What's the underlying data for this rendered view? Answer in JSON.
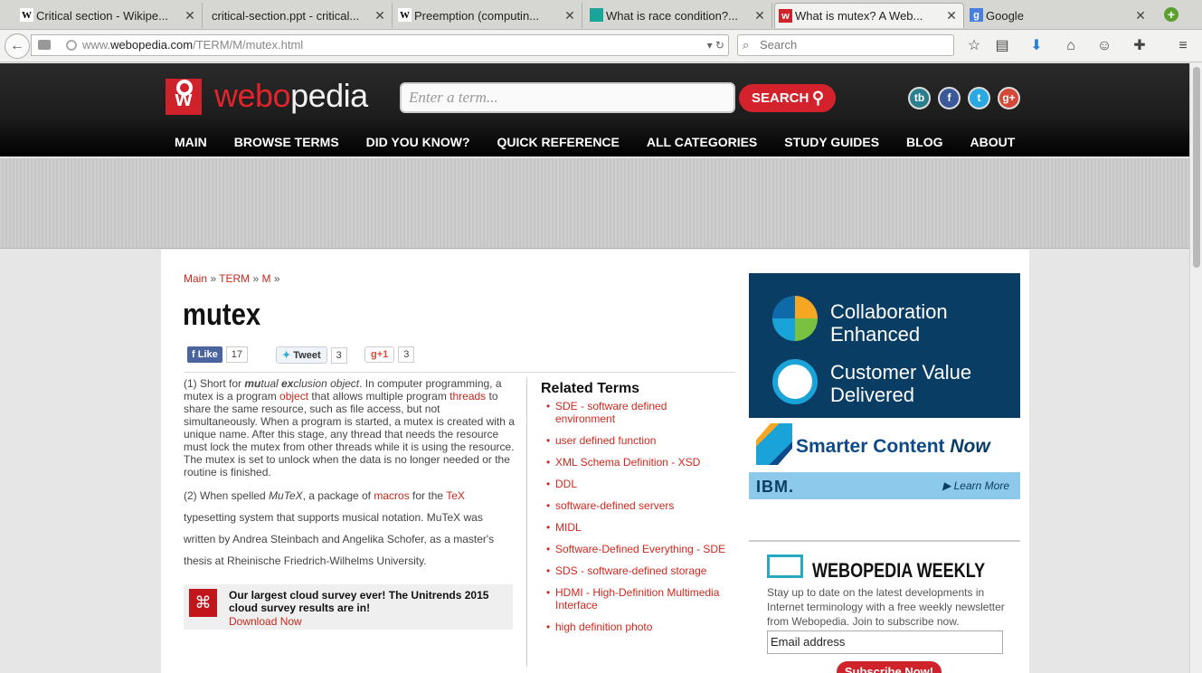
{
  "browser": {
    "tabs": [
      {
        "title": "Critical section - Wikipe...",
        "favicon": "W",
        "active": false
      },
      {
        "title": "critical-section.ppt - critical...",
        "favicon": "",
        "active": false
      },
      {
        "title": "Preemption (computin...",
        "favicon": "W",
        "active": false
      },
      {
        "title": "What is race condition?...",
        "favicon": "",
        "active": false
      },
      {
        "title": "What is mutex? A Web...",
        "favicon": "w",
        "active": true
      },
      {
        "title": "Google",
        "favicon": "g",
        "active": false
      }
    ],
    "url_domain": "www.webopedia.com",
    "url_path": "/TERM/M/mutex.html",
    "url_prefix": "www.",
    "url_host": "webopedia.com",
    "search_placeholder": "Search"
  },
  "site": {
    "logo_part1": "webo",
    "logo_part2": "pedia",
    "term_placeholder": "Enter a term...",
    "search_label": "SEARCH",
    "nav": [
      "MAIN",
      "BROWSE TERMS",
      "DID YOU KNOW?",
      "QUICK REFERENCE",
      "ALL CATEGORIES",
      "STUDY GUIDES",
      "BLOG",
      "ABOUT"
    ],
    "social": [
      {
        "name": "techbytes",
        "label": "tb",
        "color": "#2a7f8c"
      },
      {
        "name": "facebook",
        "label": "f",
        "color": "#3b5998"
      },
      {
        "name": "twitter",
        "label": "t",
        "color": "#29a9e1"
      },
      {
        "name": "googleplus",
        "label": "g+",
        "color": "#d34836"
      }
    ]
  },
  "article": {
    "breadcrumb": [
      "Main",
      "TERM",
      "M"
    ],
    "title": "mutex",
    "like_label": "Like",
    "like_count": "17",
    "tweet_label": "Tweet",
    "tweet_count": "3",
    "gplus_label": "+1",
    "gplus_count": "3",
    "def1_a": "(1) Short for ",
    "def1_mu": "mu",
    "def1_tual": "tual ",
    "def1_ex": "ex",
    "def1_clusion": "clusion object",
    "def1_b": ". In computer programming, a mutex is a program ",
    "def1_link1": "object",
    "def1_c": " that allows multiple program ",
    "def1_link2": "threads",
    "def1_d": " to share the same resource, such as file access, but not simultaneously. When a program is started, a mutex is created with a unique name. After this stage, any thread that needs the resource must lock the mutex from other threads while it is using the resource. The mutex is set to unlock when the data is no longer needed or the routine is finished.",
    "def2_a": "(2) When spelled ",
    "def2_it": "MuTeX",
    "def2_b": ", a package of ",
    "def2_link1": "macros",
    "def2_c": " for the ",
    "def2_link2": "TeX",
    "def2_d": " typesetting system that supports musical notation. MuTeX was written by Andrea Steinbach and Angelika Schofer, as a master's thesis at Rheinische Friedrich-Wilhelms University.",
    "promo_text": "Our largest cloud survey ever! The Unitrends 2015 cloud survey results are in!",
    "promo_link": "Download Now",
    "related_title": "Related Terms",
    "related": [
      "SDE - software defined environment",
      "user defined function",
      "XML Schema Definition - XSD",
      "DDL",
      "software-defined servers",
      "MIDL",
      "Software-Defined Everything - SDE",
      "SDS - software-defined storage",
      "HDMI - High-Definition Multimedia Interface",
      "high definition photo"
    ]
  },
  "sidebar": {
    "ad_line1a": "Collaboration",
    "ad_line1b": "Enhanced",
    "ad_line2a": "Customer Value",
    "ad_line2b": "Delivered",
    "ad_smarter": "Smarter Content",
    "ad_now": "Now",
    "ad_ibm": "IBM.",
    "ad_learn": "Learn More",
    "weekly_title": "WEBOPEDIA WEEKLY",
    "weekly_desc": "Stay up to date on the latest developments in Internet terminology with a free weekly newsletter from Webopedia. Join to subscribe now.",
    "email_value": "Email address",
    "subscribe_label": "Subscribe Now!"
  }
}
